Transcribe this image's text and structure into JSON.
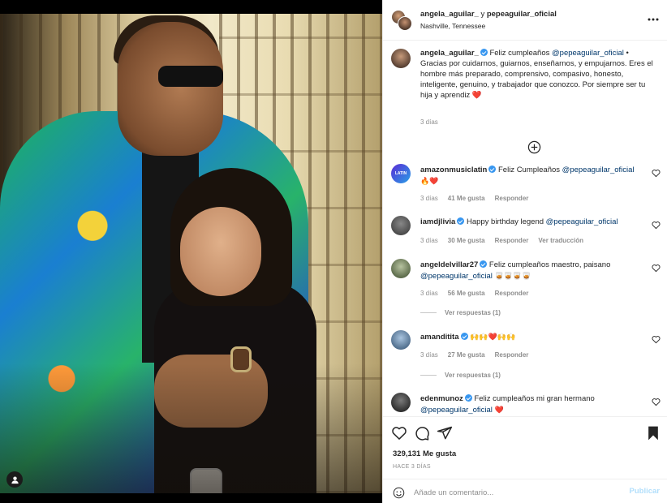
{
  "post": {
    "header": {
      "user1": "angela_aguilar_",
      "joiner": " y ",
      "user2": "pepeaguilar_oficial",
      "location": "Nashville, Tennessee"
    },
    "caption": {
      "username": "angela_aguilar_",
      "text_before": " Feliz cumpleaños ",
      "mention": "@pepeaguilar_oficial",
      "text_after": " • Gracias por cuidarnos, guiarnos, enseñarnos, y empujarnos. Eres el hombre más preparado, comprensivo, compasivo, honesto, inteligente, genuino, y trabajador que conozco. Por siempre ser tu hija y aprendiz",
      "heart": "❤️",
      "time": "3 días"
    },
    "comments": [
      {
        "username": "amazonmusiclatin",
        "text": " Feliz Cumpleaños ",
        "mention": "@pepeaguilar_oficial",
        "emojis": "🔥❤️",
        "time": "3 días",
        "likes": "41 Me gusta",
        "reply": "Responder",
        "avatar_color": "#3f4bd8",
        "avatar_label": "LATIN"
      },
      {
        "username": "iamdjlivia",
        "text": " Happy birthday legend ",
        "mention": "@pepeaguilar_oficial",
        "time": "3 días",
        "likes": "30 Me gusta",
        "reply": "Responder",
        "translate": "Ver traducción",
        "avatar_color": "#5a5a5a"
      },
      {
        "username": "angeldelvillar27",
        "text": " Feliz cumpleaños maestro, paisano",
        "mention": "@pepeaguilar_oficial",
        "emojis": "🥃🥃🥃🥃",
        "time": "3 días",
        "likes": "56 Me gusta",
        "reply": "Responder",
        "replies": "Ver respuestas (1)",
        "avatar_color": "#7d8a6e"
      },
      {
        "username": "amanditita",
        "emojis": "🙌🙌❤️🙌🙌",
        "time": "3 días",
        "likes": "27 Me gusta",
        "reply": "Responder",
        "replies": "Ver respuestas (1)",
        "avatar_color": "#6a88a8"
      },
      {
        "username": "edenmunoz",
        "text": " Feliz cumpleaños mi gran hermano",
        "mention": "@pepeaguilar_oficial",
        "emojis": "❤️",
        "avatar_color": "#2a2a2a"
      }
    ],
    "likes": "329,131 Me gusta",
    "date": "HACE 3 DÍAS",
    "add_comment": {
      "placeholder": "Añade un comentario...",
      "publish": "Publicar"
    },
    "icons": {
      "more": "more-options-icon",
      "like": "heart-icon",
      "comment": "comment-icon",
      "share": "share-icon",
      "save": "bookmark-icon",
      "emoji": "emoji-icon",
      "load_more": "plus-circle-icon",
      "user_tag": "user-tag-icon"
    },
    "colors": {
      "link": "#00376b",
      "verified": "#3897f0",
      "muted": "#8e8e8e",
      "publish_disabled": "#b2dffc"
    }
  }
}
